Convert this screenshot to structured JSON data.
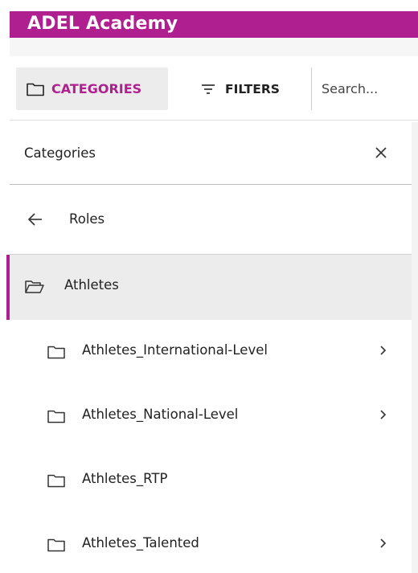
{
  "app": {
    "title": "ADEL Academy"
  },
  "toolbar": {
    "categories_label": "CATEGORIES",
    "filters_label": "FILTERS",
    "search_placeholder": "Search..."
  },
  "panel": {
    "title": "Categories",
    "back_label": "Roles",
    "active_label": "Athletes",
    "items": [
      {
        "label": "Athletes_International-Level",
        "has_children": true
      },
      {
        "label": "Athletes_National-Level",
        "has_children": true
      },
      {
        "label": "Athletes_RTP",
        "has_children": false
      },
      {
        "label": "Athletes_Talented",
        "has_children": true
      }
    ]
  },
  "colors": {
    "brand": "#b01f8f",
    "active_bg": "#ececec"
  },
  "icons": {
    "categories": "folder-icon",
    "filters": "filter-icon",
    "close": "close-icon",
    "back": "arrow-left-icon",
    "active": "folder-open-icon",
    "item": "folder-icon",
    "chevron": "chevron-right-icon"
  }
}
